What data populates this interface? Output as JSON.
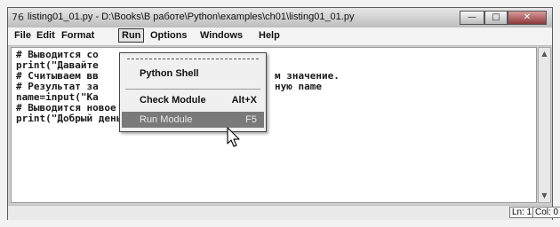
{
  "window": {
    "app_icon": "76",
    "title": "listing01_01.py - D:\\Books\\В работе\\Python\\examples\\ch01\\listing01_01.py",
    "controls": {
      "minimize": "—",
      "maximize": "□",
      "close": "✕"
    }
  },
  "menubar": {
    "items": [
      "File",
      "Edit",
      "Format",
      "Run",
      "Options",
      "Windows",
      "Help"
    ],
    "active": "Run"
  },
  "editor": {
    "lines": [
      "# Выводится со",
      "print(\"Давайте",
      "# Считываем вв",
      "# Результат за",
      "name=input(\"Ка",
      "# Выводится новое сообщение",
      "print(\"Добрый день,\",name+\"!\")"
    ],
    "line_tails": [
      "",
      "",
      "м значение.",
      "ную name",
      "",
      "",
      ""
    ]
  },
  "run_menu": {
    "items": [
      {
        "label": "Python Shell",
        "shortcut": ""
      },
      {
        "label": "Check Module",
        "shortcut": "Alt+X"
      },
      {
        "label": "Run Module",
        "shortcut": "F5"
      }
    ],
    "highlighted": "Run Module"
  },
  "statusbar": {
    "line": "Ln: 1",
    "col": "Col: 0"
  },
  "icons": {
    "app": "python-idle-icon",
    "scroll_up": "arrow-up-icon",
    "scroll_down": "arrow-down-icon",
    "cursor": "mouse-pointer-icon"
  },
  "colors": {
    "menu_highlight": "#7a7a7a",
    "close_button": "#8c3a3a",
    "editor_bg": "#ffffff"
  }
}
